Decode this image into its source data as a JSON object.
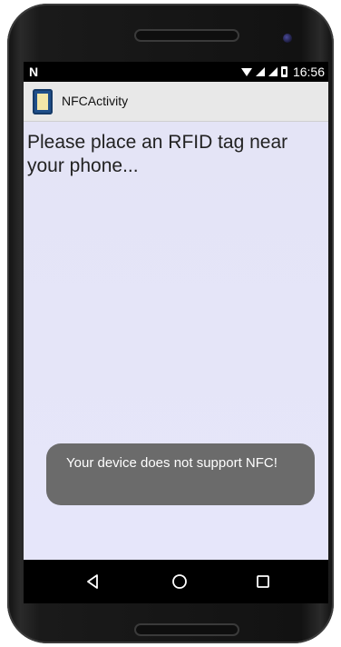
{
  "status_bar": {
    "time": "16:56",
    "left_icon": "nfc-n-icon",
    "left_glyph": "N",
    "icons": [
      "wifi-icon",
      "signal-icon",
      "signal-icon",
      "battery-icon"
    ]
  },
  "action_bar": {
    "title": "NFCActivity",
    "icon": "app-launcher-icon"
  },
  "content": {
    "message": "Please place an RFID tag near your phone..."
  },
  "toast": {
    "text": "Your device does not support NFC!"
  },
  "nav_bar": {
    "buttons": [
      "back-icon",
      "home-icon",
      "recents-icon"
    ]
  },
  "colors": {
    "screen_bg": "#e6e6f8",
    "action_bar_bg": "#e8e8e8",
    "toast_bg": "#6b6b6b",
    "nav_bg": "#000000",
    "status_bg": "#000000"
  }
}
